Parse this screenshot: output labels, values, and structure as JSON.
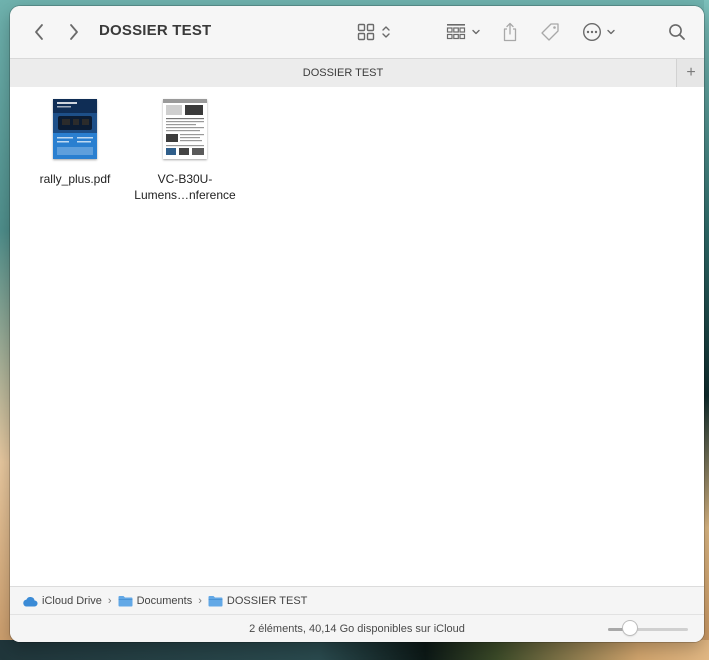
{
  "window": {
    "title": "DOSSIER TEST"
  },
  "tabs": [
    {
      "label": "DOSSIER TEST"
    }
  ],
  "tab_add_label": "+",
  "files": [
    {
      "name": "rally_plus.pdf",
      "kind": "pdf-blue-thumbnail"
    },
    {
      "name": "VC-B30U-\nLumens…nference",
      "kind": "pdf-white-thumbnail"
    }
  ],
  "pathbar": {
    "items": [
      {
        "label": "iCloud Drive",
        "icon": "icloud-icon"
      },
      {
        "label": "Documents",
        "icon": "folder-icon"
      },
      {
        "label": "DOSSIER TEST",
        "icon": "folder-icon"
      }
    ],
    "separator": "›"
  },
  "status": {
    "text": "2 éléments, 40,14 Go disponibles sur iCloud",
    "icon_size_slider_value": 0.28
  },
  "colors": {
    "accent": "#3b8bd6",
    "folder": "#62a8e6"
  }
}
